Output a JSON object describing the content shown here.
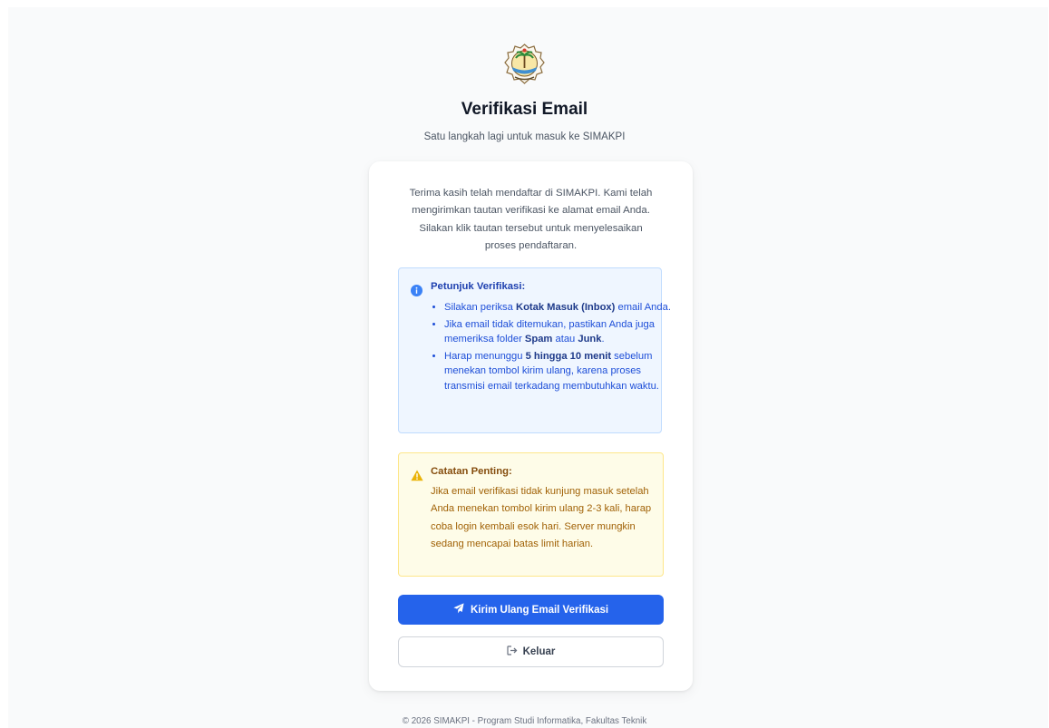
{
  "header": {
    "title": "Verifikasi Email",
    "subtitle": "Satu langkah lagi untuk masuk ke SIMAKPI"
  },
  "card": {
    "intro": "Terima kasih telah mendaftar di SIMAKPI. Kami telah mengirimkan tautan verifikasi ke alamat email Anda. Silakan klik tautan tersebut untuk menyelesaikan proses pendaftaran."
  },
  "info": {
    "icon": "info-circle-icon",
    "heading": "Petunjuk Verifikasi:",
    "items": [
      {
        "pre": "Silakan periksa ",
        "b1": "Kotak Masuk (Inbox)",
        "mid": " email Anda.",
        "b2": "",
        "post": ""
      },
      {
        "pre": "Jika email tidak ditemukan, pastikan Anda juga memeriksa folder ",
        "b1": "Spam",
        "mid": " atau ",
        "b2": "Junk",
        "post": "."
      },
      {
        "pre": "Harap menunggu ",
        "b1": "5 hingga 10 menit",
        "mid": " sebelum menekan tombol kirim ulang, karena proses transmisi email terkadang membutuhkan waktu.",
        "b2": "",
        "post": ""
      }
    ]
  },
  "warning": {
    "icon": "warning-triangle-icon",
    "heading": "Catatan Penting:",
    "text": "Jika email verifikasi tidak kunjung masuk setelah Anda menekan tombol kirim ulang 2-3 kali, harap coba login kembali esok hari. Server mungkin sedang mencapai batas limit harian."
  },
  "buttons": {
    "resend_label": "Kirim Ulang Email Verifikasi",
    "resend_icon": "paper-plane-icon",
    "logout_label": "Keluar",
    "logout_icon": "sign-out-icon"
  },
  "footer": {
    "text": "© 2026 SIMAKPI - Program Studi Informatika, Fakultas Teknik"
  },
  "colors": {
    "primary": "#2563eb",
    "info_bg": "#eff6ff",
    "info_text": "#1d4ed8",
    "warn_bg": "#fefce8",
    "warn_text": "#a16207",
    "warn_icon": "#eab308"
  }
}
